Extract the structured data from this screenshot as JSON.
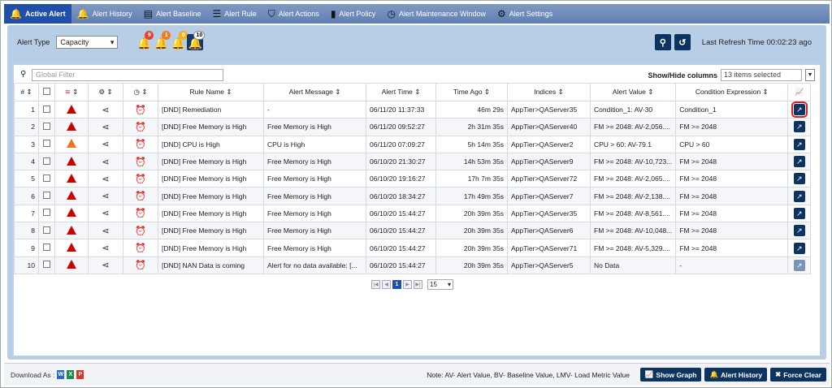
{
  "tabs": [
    {
      "label": "Active Alert",
      "icon": "bell-icon",
      "glyph": "🔔"
    },
    {
      "label": "Alert History",
      "icon": "bell-icon",
      "glyph": "🔔"
    },
    {
      "label": "Alert Baseline",
      "icon": "baseline-icon",
      "glyph": "▤"
    },
    {
      "label": "Alert Rule",
      "icon": "rule-icon",
      "glyph": "☰"
    },
    {
      "label": "Alert Actions",
      "icon": "bookmark-icon",
      "glyph": "⛉"
    },
    {
      "label": "Alert Policy",
      "icon": "policy-icon",
      "glyph": "▮"
    },
    {
      "label": "Alert Maintenance Window",
      "icon": "maintenance-icon",
      "glyph": "◷"
    },
    {
      "label": "Alert Settings",
      "icon": "gear-icon",
      "glyph": "⚙"
    }
  ],
  "toolbar": {
    "alert_type_label": "Alert Type",
    "alert_type_value": "Capacity",
    "bells": [
      {
        "count": "9",
        "color": "#e8412c"
      },
      {
        "count": "1",
        "color": "#f0781e"
      },
      {
        "count": "0",
        "color": "#f2b21c"
      },
      {
        "count": "10",
        "color": "#ffffff"
      }
    ],
    "refresh_label": "Last Refresh Time 00:02:23 ago"
  },
  "filter": {
    "placeholder": "Global Filter",
    "showhide_label": "Show/Hide columns",
    "showhide_value": "13 items selected"
  },
  "columns": [
    "#",
    "",
    "",
    "",
    "",
    "Rule Name",
    "Alert Message",
    "Alert Time",
    "Time Ago",
    "Indices",
    "Alert Value",
    "Condition Expression",
    ""
  ],
  "rows": [
    {
      "num": "1",
      "sev": "critical",
      "rule": "[DND] Remediation",
      "msg": "-",
      "time": "06/11/20 11:37:33",
      "ago": "46m 29s",
      "idx": "AppTier>QAServer35",
      "val": "Condition_1: AV-30",
      "cond": "Condition_1"
    },
    {
      "num": "2",
      "sev": "critical",
      "rule": "[DND] Free Memory is High",
      "msg": "Free Memory is High",
      "time": "06/11/20 09:52:27",
      "ago": "2h 31m 35s",
      "idx": "AppTier>QAServer40",
      "val": "FM >= 2048: AV-2,056....",
      "cond": "FM >= 2048"
    },
    {
      "num": "3",
      "sev": "major",
      "rule": "[DND] CPU is High",
      "msg": "CPU is High",
      "time": "06/11/20 07:09:27",
      "ago": "5h 14m 35s",
      "idx": "AppTier>QAServer2",
      "val": "CPU > 60: AV-79.1",
      "cond": "CPU > 60"
    },
    {
      "num": "4",
      "sev": "critical",
      "rule": "[DND] Free Memory is High",
      "msg": "Free Memory is High",
      "time": "06/10/20 21:30:27",
      "ago": "14h 53m 35s",
      "idx": "AppTier>QAServer9",
      "val": "FM >= 2048: AV-10,723...",
      "cond": "FM >= 2048"
    },
    {
      "num": "5",
      "sev": "critical",
      "rule": "[DND] Free Memory is High",
      "msg": "Free Memory is High",
      "time": "06/10/20 19:16:27",
      "ago": "17h 7m 35s",
      "idx": "AppTier>QAServer72",
      "val": "FM >= 2048: AV-2,065....",
      "cond": "FM >= 2048"
    },
    {
      "num": "6",
      "sev": "critical",
      "rule": "[DND] Free Memory is High",
      "msg": "Free Memory is High",
      "time": "06/10/20 18:34:27",
      "ago": "17h 49m 35s",
      "idx": "AppTier>QAServer7",
      "val": "FM >= 2048: AV-2,138....",
      "cond": "FM >= 2048"
    },
    {
      "num": "7",
      "sev": "critical",
      "rule": "[DND] Free Memory is High",
      "msg": "Free Memory is High",
      "time": "06/10/20 15:44:27",
      "ago": "20h 39m 35s",
      "idx": "AppTier>QAServer35",
      "val": "FM >= 2048: AV-8,561....",
      "cond": "FM >= 2048"
    },
    {
      "num": "8",
      "sev": "critical",
      "rule": "[DND] Free Memory is High",
      "msg": "Free Memory is High",
      "time": "06/10/20 15:44:27",
      "ago": "20h 39m 35s",
      "idx": "AppTier>QAServer6",
      "val": "FM >= 2048: AV-10,048...",
      "cond": "FM >= 2048"
    },
    {
      "num": "9",
      "sev": "critical",
      "rule": "[DND] Free Memory is High",
      "msg": "Free Memory is High",
      "time": "06/10/20 15:44:27",
      "ago": "20h 39m 35s",
      "idx": "AppTier>QAServer71",
      "val": "FM >= 2048: AV-5,329....",
      "cond": "FM >= 2048"
    },
    {
      "num": "10",
      "sev": "critical",
      "rule": "[DND] NAN Data is coming",
      "msg": "Alert for no data available: [...",
      "time": "06/10/20 15:44:27",
      "ago": "20h 39m 35s",
      "idx": "AppTier>QAServer5",
      "val": "No Data",
      "cond": "-"
    }
  ],
  "pager": {
    "current": "1",
    "page_size": "15"
  },
  "footer": {
    "download_label": "Download As :",
    "note": "Note: AV- Alert Value, BV- Baseline Value, LMV- Load Metric Value",
    "show_graph": "Show Graph",
    "alert_history": "Alert History",
    "force_clear": "Force Clear"
  }
}
